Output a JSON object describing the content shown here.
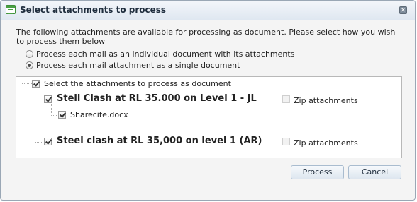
{
  "dialog": {
    "title": "Select attachments to process",
    "icon": "dialog-window-icon",
    "close_icon": "close-icon"
  },
  "intro_text": "The following attachments are available for processing as document. Please select how you wish to process them below",
  "options": [
    {
      "label": "Process each mail as an individual document with its attachments",
      "selected": false
    },
    {
      "label": "Process each mail attachment as a single document",
      "selected": true
    }
  ],
  "tree": {
    "root": {
      "label": "Select the attachments to process as document",
      "checked": true
    },
    "mails": [
      {
        "label": "Stell Clash at RL 35.000 on Level 1 - JL",
        "checked": true,
        "zip_label": "Zip attachments",
        "zip_checked": false,
        "attachments": [
          {
            "label": "Sharecite.docx",
            "checked": true
          }
        ]
      },
      {
        "label": "Steel clash at RL 35,000 on level 1 (AR)",
        "checked": true,
        "zip_label": "Zip attachments",
        "zip_checked": false,
        "attachments": []
      }
    ]
  },
  "buttons": {
    "process_label": "Process",
    "cancel_label": "Cancel"
  }
}
